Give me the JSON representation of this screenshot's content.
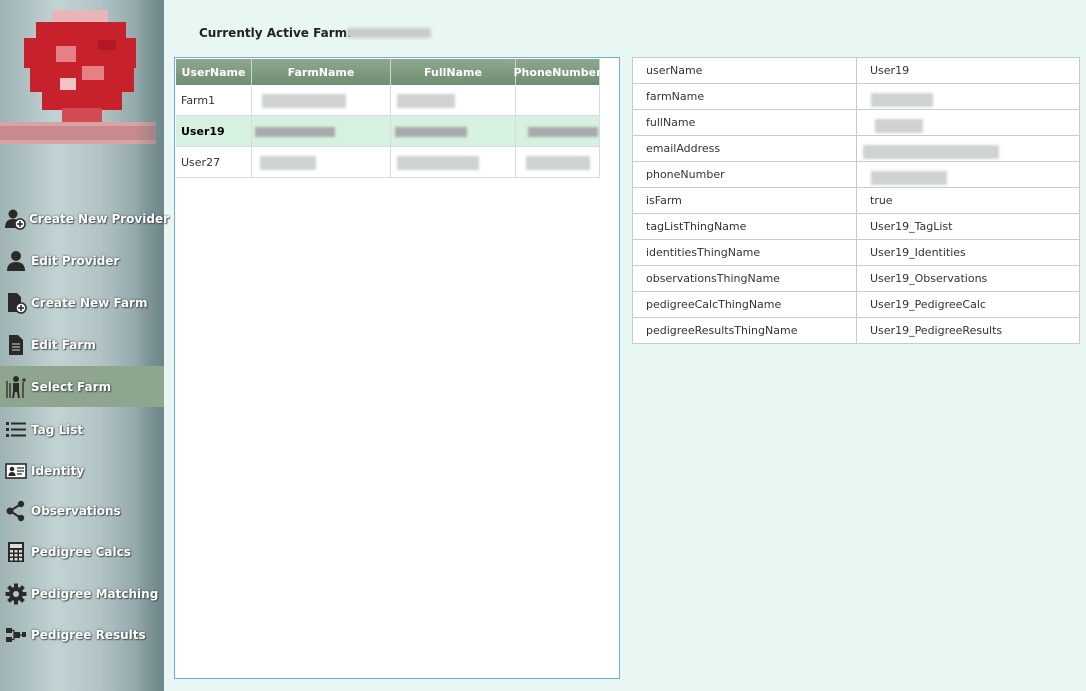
{
  "sidebar": {
    "items": [
      {
        "label": "Create New Provider",
        "icon": "add-user-icon"
      },
      {
        "label": "Edit Provider",
        "icon": "user-icon"
      },
      {
        "label": "Create New Farm",
        "icon": "add-document-icon"
      },
      {
        "label": "Edit Farm",
        "icon": "document-icon"
      },
      {
        "label": "Select Farm",
        "icon": "farmer-icon",
        "active": true
      },
      {
        "label": "Tag List",
        "icon": "list-icon"
      },
      {
        "label": "Identity",
        "icon": "id-card-icon"
      },
      {
        "label": "Observations",
        "icon": "share-icon"
      },
      {
        "label": "Pedigree Calcs",
        "icon": "calculator-icon"
      },
      {
        "label": "Pedigree Matching",
        "icon": "gear-icon"
      },
      {
        "label": "Pedigree Results",
        "icon": "hierarchy-icon"
      }
    ]
  },
  "header": {
    "active_farm_label": "Currently Active Farm:"
  },
  "grid": {
    "columns": [
      "UserName",
      "FarmName",
      "FullName",
      "PhoneNumber"
    ],
    "rows": [
      {
        "username": "Farm1"
      },
      {
        "username": "User19",
        "selected": true
      },
      {
        "username": "User27"
      }
    ]
  },
  "properties": [
    {
      "key": "userName",
      "value": "User19"
    },
    {
      "key": "farmName",
      "value": ""
    },
    {
      "key": "fullName",
      "value": ""
    },
    {
      "key": "emailAddress",
      "value": ""
    },
    {
      "key": "phoneNumber",
      "value": ""
    },
    {
      "key": "isFarm",
      "value": "true"
    },
    {
      "key": "tagListThingName",
      "value": "User19_TagList"
    },
    {
      "key": "identitiesThingName",
      "value": "User19_Identities"
    },
    {
      "key": "observationsThingName",
      "value": "User19_Observations"
    },
    {
      "key": "pedigreeCalcThingName",
      "value": "User19_PedigreeCalc"
    },
    {
      "key": "pedigreeResultsThingName",
      "value": "User19_PedigreeResults"
    }
  ],
  "colors": {
    "nav_active": "#8ea58e",
    "grid_header": "#7a967a",
    "selected_row": "#d6f1df",
    "background": "#e8f6f4"
  }
}
